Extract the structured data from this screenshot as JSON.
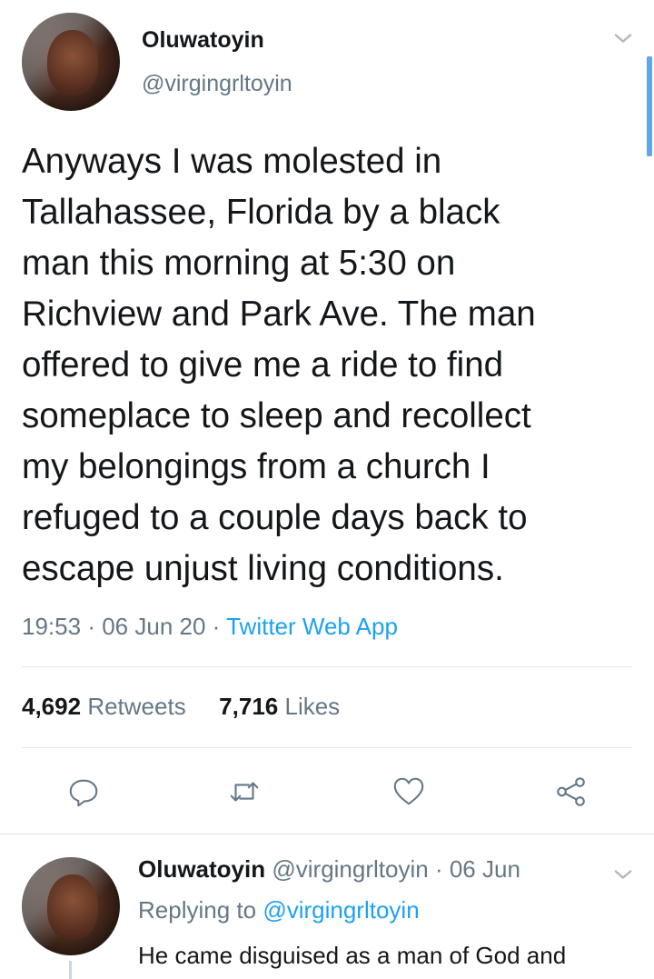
{
  "tweet": {
    "author_name": "Oluwatoyin",
    "author_handle": "@virgingrltoyin",
    "menu_icon": "chevron-down-icon",
    "text": "Anyways I was molested in\nTallahassee, Florida by a black\nman this morning at 5:30 on\nRichview and Park Ave. The man\noffered to give me a ride to find\nsomeplace to sleep and recollect\nmy belongings from a church I\nrefuged to a couple days back to\nescape unjust living conditions.",
    "time": "19:53",
    "date": "06 Jun 20",
    "separator": "·",
    "source": "Twitter Web App",
    "retweets_count": "4,692",
    "retweets_label": "Retweets",
    "likes_count": "7,716",
    "likes_label": "Likes",
    "actions": [
      {
        "name": "reply-icon"
      },
      {
        "name": "retweet-icon"
      },
      {
        "name": "like-icon"
      },
      {
        "name": "share-icon"
      }
    ]
  },
  "reply": {
    "author_name": "Oluwatoyin",
    "author_handle": "@virgingrltoyin",
    "separator": "·",
    "date": "06 Jun",
    "replying_to_label": "Replying to",
    "replying_to_handle": "@virgingrltoyin",
    "text": "He came disguised as a man of God and",
    "menu_icon": "chevron-down-icon"
  },
  "colors": {
    "accent": "#1da1f2",
    "muted": "#657786",
    "text": "#14171a",
    "divider": "#e1e8ed",
    "scrollbar": "#5fa7e6"
  }
}
